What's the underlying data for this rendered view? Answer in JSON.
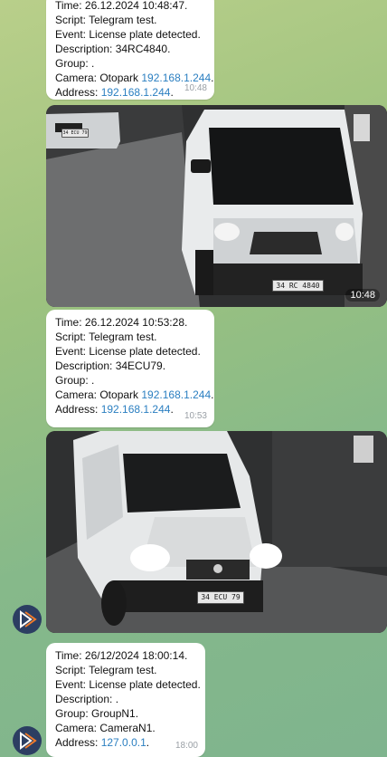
{
  "messages": [
    {
      "lines": [
        "Time: 26.12.2024 10:48:47.",
        "Script: Telegram test.",
        "Event: License plate detected.",
        "Description: 34RC4840.",
        "Group: ."
      ],
      "camera_label": "Camera: Otopark ",
      "camera_link": "192.168.1.244",
      "camera_suffix": ".",
      "address_label": "Address: ",
      "address_link": "192.168.1.244",
      "address_suffix": ".",
      "time": "10:48"
    },
    {
      "lines": [
        "Time: 26.12.2024 10:53:28.",
        "Script: Telegram test.",
        "Event: License plate detected.",
        "Description: 34ECU79.",
        "Group: ."
      ],
      "camera_label": "Camera: Otopark ",
      "camera_link": "192.168.1.244",
      "camera_suffix": ".",
      "address_label": "Address: ",
      "address_link": "192.168.1.244",
      "address_suffix": ".",
      "time": "10:53"
    },
    {
      "lines": [
        "Time: 26/12/2024 18:00:14.",
        "Script: Telegram test.",
        "Event: License plate detected.",
        "Description: .",
        "Group: GroupN1.",
        "Camera: CameraN1."
      ],
      "address_label": "Address: ",
      "address_link": "127.0.0.1",
      "address_suffix": ".",
      "time": "18:00"
    }
  ],
  "photos": [
    {
      "time": "10:48",
      "plate_main": "34 RC 4840",
      "plate_small": "34 ECU 79"
    },
    {
      "time": "",
      "plate_main": "34 ECU 79"
    }
  ],
  "colors": {
    "link": "#2b7fc1",
    "bubble": "#ffffff",
    "avatar": "#2c3e62",
    "avatar_accent": "#f07a2a"
  }
}
